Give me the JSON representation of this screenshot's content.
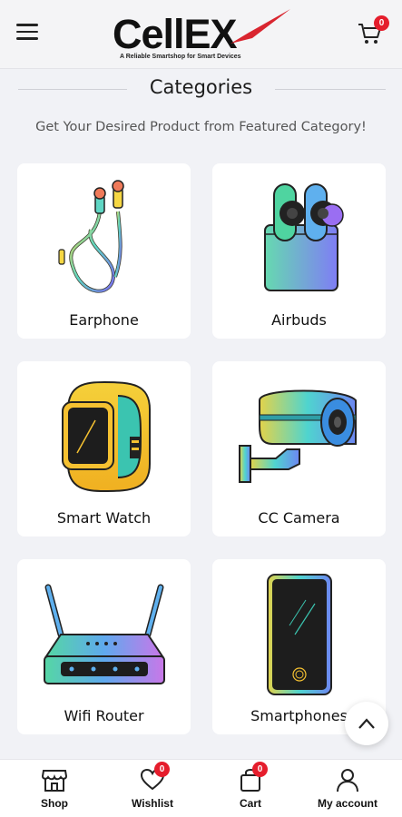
{
  "header": {
    "logo_text": "CellEX",
    "logo_tagline": "A Reliable Smartshop for Smart Devices",
    "cart_count": "0",
    "icons": [
      "menu-icon",
      "cart-icon"
    ]
  },
  "section": {
    "title": "Categories",
    "subtitle": "Get Your Desired Product from Featured Category!"
  },
  "categories": [
    {
      "label": "Earphone",
      "icon": "earphone-icon"
    },
    {
      "label": "Airbuds",
      "icon": "airbuds-icon"
    },
    {
      "label": "Smart Watch",
      "icon": "smart-watch-icon"
    },
    {
      "label": "CC Camera",
      "icon": "cc-camera-icon"
    },
    {
      "label": "Wifi Router",
      "icon": "wifi-router-icon"
    },
    {
      "label": "Smartphones",
      "icon": "smartphone-icon"
    }
  ],
  "bottom_nav": [
    {
      "label": "Shop",
      "icon": "shop-icon"
    },
    {
      "label": "Wishlist",
      "icon": "heart-icon",
      "badge": "0"
    },
    {
      "label": "Cart",
      "icon": "bag-icon",
      "badge": "0"
    },
    {
      "label": "My account",
      "icon": "user-icon"
    }
  ],
  "colors": {
    "badge": "#e51d2c",
    "accent_red": "#d9252f",
    "background": "#f1f2f6",
    "card": "#ffffff"
  }
}
